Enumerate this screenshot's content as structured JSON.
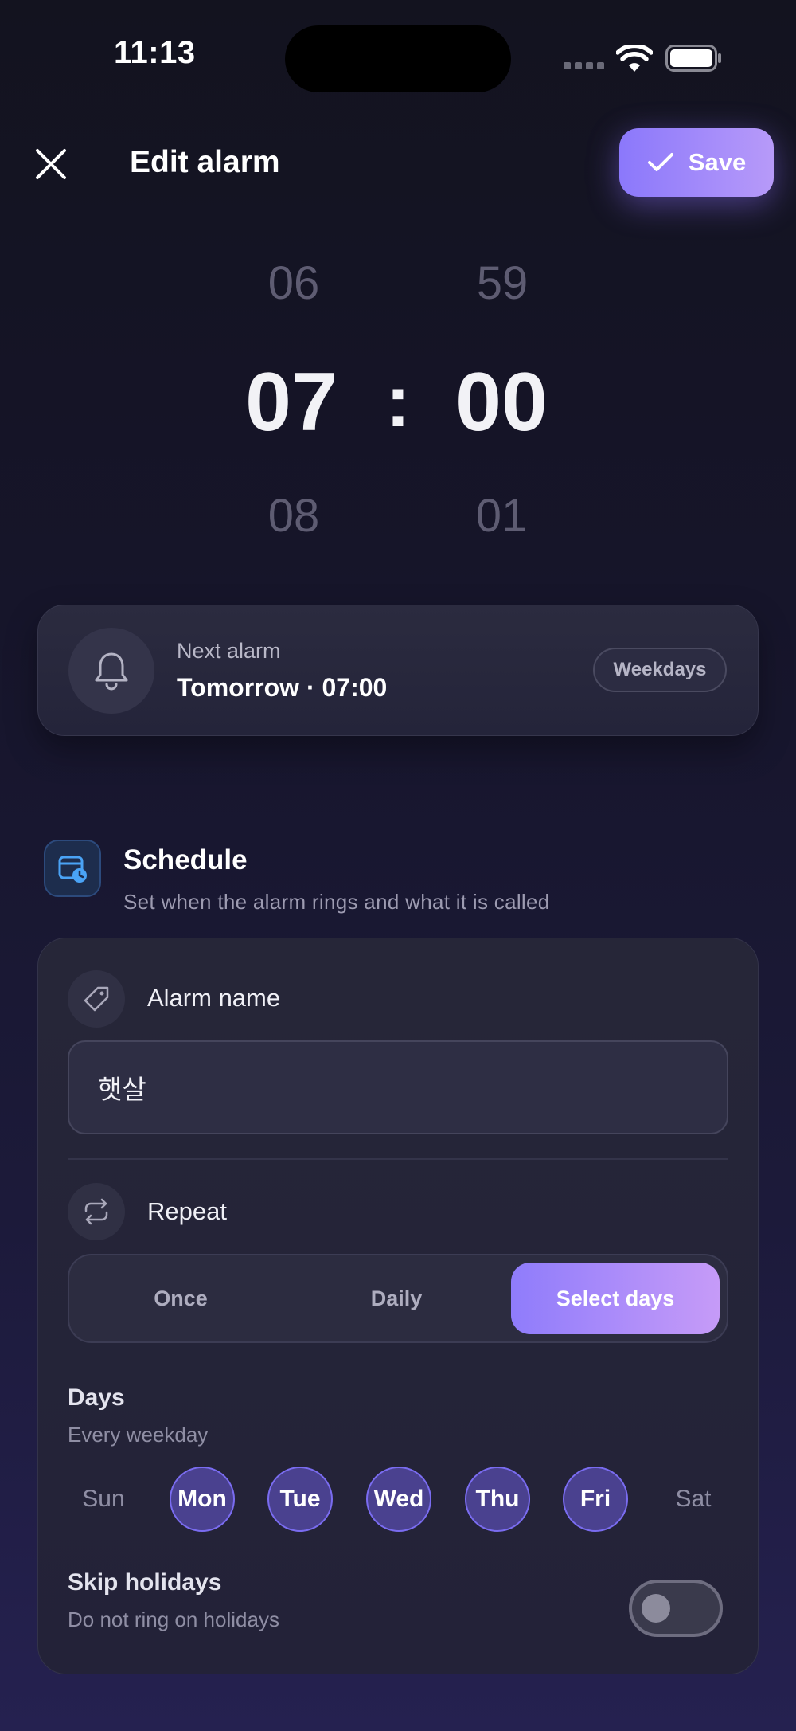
{
  "status_bar": {
    "time": "11:13"
  },
  "header": {
    "title": "Edit alarm",
    "save_label": "Save"
  },
  "time_picker": {
    "hour_prev": "06",
    "hour": "07",
    "hour_next": "08",
    "separator": ":",
    "minute_prev": "59",
    "minute": "00",
    "minute_next": "01"
  },
  "next_alarm": {
    "label": "Next alarm",
    "value": "Tomorrow · 07:00",
    "badge": "Weekdays"
  },
  "schedule": {
    "title": "Schedule",
    "subtitle": "Set when the alarm rings and what it is called",
    "alarm_name_label": "Alarm name",
    "alarm_name_value": "햇살",
    "repeat_label": "Repeat",
    "repeat_options": [
      "Once",
      "Daily",
      "Select days"
    ],
    "repeat_selected": "Select days",
    "days_title": "Days",
    "days_subtitle": "Every weekday",
    "days": [
      {
        "label": "Sun",
        "selected": false
      },
      {
        "label": "Mon",
        "selected": true
      },
      {
        "label": "Tue",
        "selected": true
      },
      {
        "label": "Wed",
        "selected": true
      },
      {
        "label": "Thu",
        "selected": true
      },
      {
        "label": "Fri",
        "selected": true
      },
      {
        "label": "Sat",
        "selected": false
      }
    ],
    "skip_holidays_title": "Skip holidays",
    "skip_holidays_subtitle": "Do not ring on holidays",
    "skip_holidays_on": false
  },
  "colors": {
    "accent_start": "#8b78fb",
    "accent_end": "#c69bf8",
    "background": "#16152a",
    "card": "#262638"
  },
  "icons": [
    "close-icon",
    "check-icon",
    "bell-icon",
    "calendar-clock-icon",
    "tag-icon",
    "repeat-icon",
    "wifi-icon",
    "battery-icon"
  ]
}
